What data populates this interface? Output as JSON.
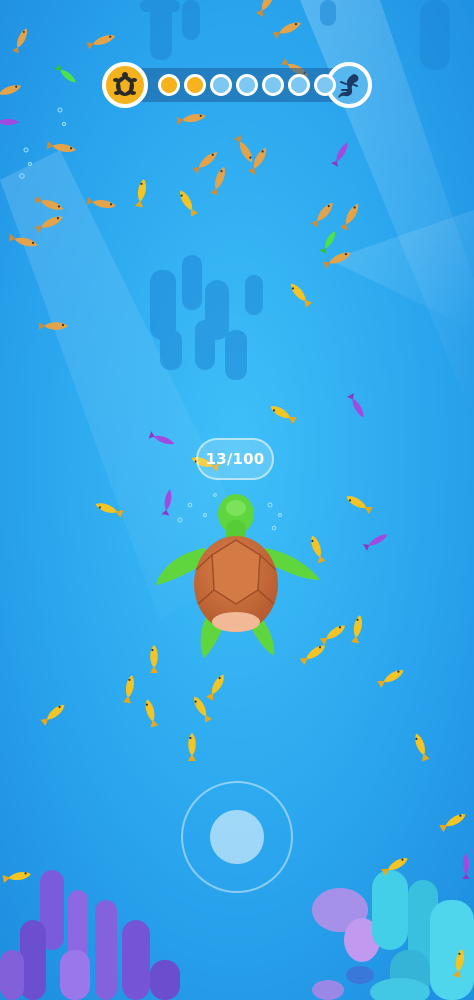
{
  "game": {
    "player": "sea-turtle",
    "colors": {
      "water": "#2ea9f2",
      "hud_bar": "#1b5d99",
      "turtle_shell": "#c86c3b",
      "turtle_skin": "#5fd63e",
      "small_fish": "#f2c524",
      "purple_fish": "#a04be0",
      "green_fish": "#4de14b"
    }
  },
  "hud": {
    "current_stage_icon": "turtle-icon",
    "next_stage_icon": "lizard-icon",
    "progress_dots": [
      {
        "state": "filled",
        "color": "#f7b21c"
      },
      {
        "state": "filled",
        "color": "#f7b21c"
      },
      {
        "state": "empty",
        "color": "#7cc8f3"
      },
      {
        "state": "empty",
        "color": "#7cc8f3"
      },
      {
        "state": "empty",
        "color": "#7cc8f3"
      },
      {
        "state": "empty",
        "color": "#7cc8f3"
      },
      {
        "state": "empty",
        "color": "#7cc8f3"
      }
    ]
  },
  "counter": {
    "text": "13/100",
    "eaten": 13,
    "goal": 100
  },
  "joystick": {
    "icon": "virtual-joystick"
  }
}
